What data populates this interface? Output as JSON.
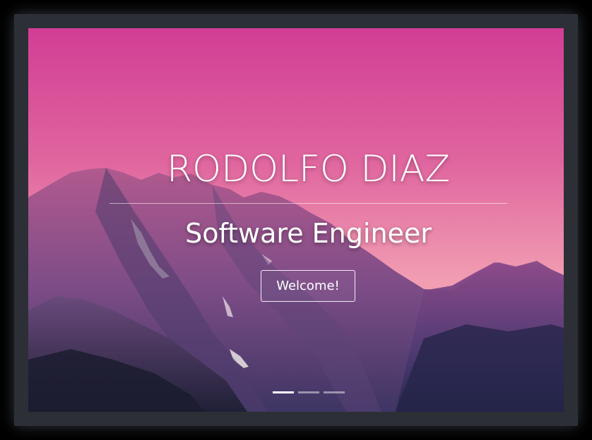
{
  "hero": {
    "name": "RODOLFO DIAZ",
    "title": "Software Engineer",
    "button_label": "Welcome!"
  },
  "carousel": {
    "slide_count": 3,
    "active_index": 0
  },
  "colors": {
    "sky_top": "#d63f96",
    "sky_bottom": "#f3a4b6",
    "mountain_dark": "#2a2848",
    "frame": "#2c3036"
  }
}
